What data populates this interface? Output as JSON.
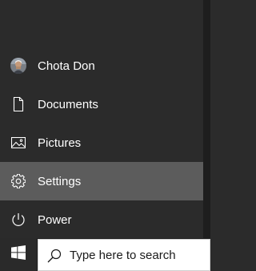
{
  "start_menu": {
    "items": [
      {
        "label": "Chota Don",
        "icon": "user-avatar"
      },
      {
        "label": "Documents",
        "icon": "document-icon"
      },
      {
        "label": "Pictures",
        "icon": "pictures-icon"
      },
      {
        "label": "Settings",
        "icon": "gear-icon"
      },
      {
        "label": "Power",
        "icon": "power-icon"
      }
    ]
  },
  "taskbar": {
    "search_placeholder": "Type here to search",
    "start_icon": "windows-logo-icon"
  }
}
